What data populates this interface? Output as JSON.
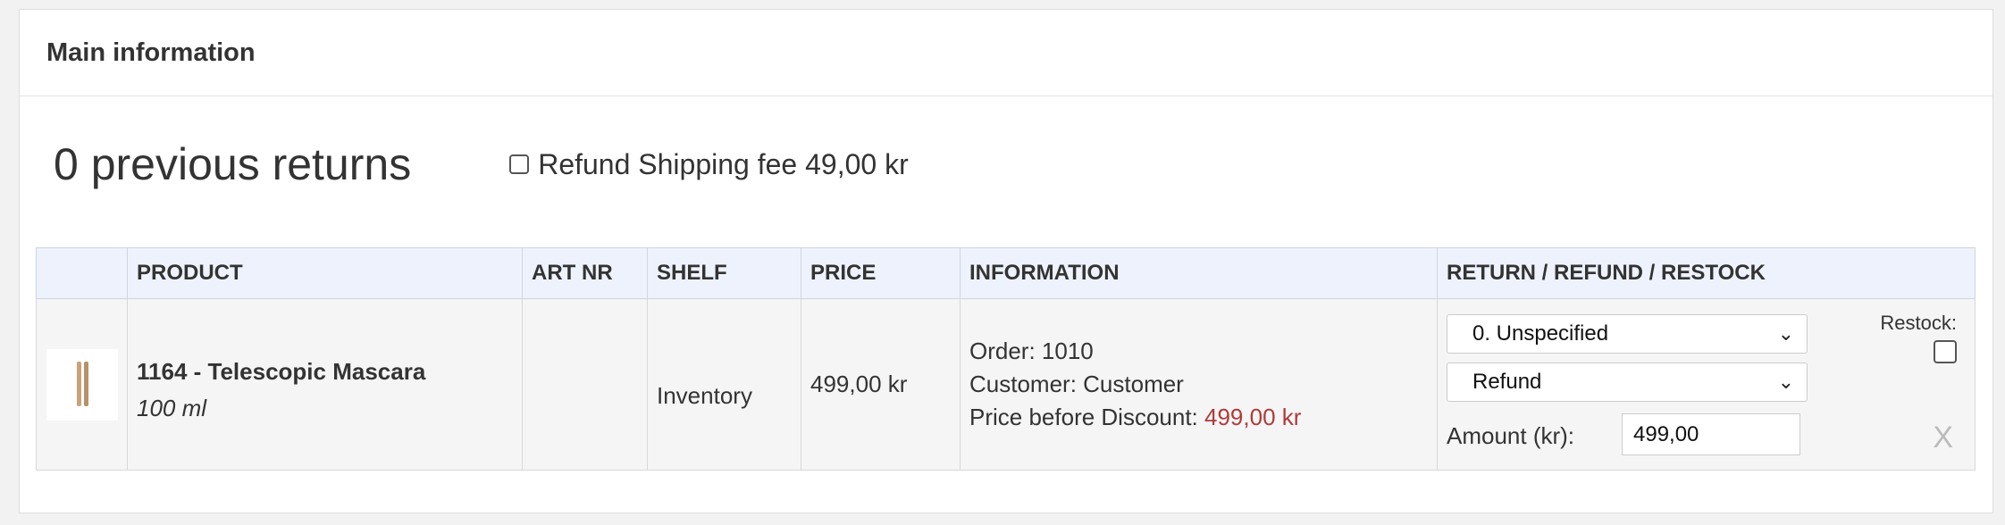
{
  "card": {
    "title": "Main information"
  },
  "summary": {
    "previous_returns": "0 previous returns",
    "refund_shipping_label": "Refund Shipping fee 49,00 kr"
  },
  "table": {
    "headers": [
      "",
      "PRODUCT",
      "ART NR",
      "SHELF",
      "PRICE",
      "INFORMATION",
      "RETURN / REFUND / RESTOCK"
    ],
    "rows": [
      {
        "product_name": "1164 - Telescopic Mascara",
        "product_size": "100 ml",
        "art_nr": "",
        "shelf": "Inventory",
        "price": "499,00 kr",
        "info": {
          "order": "Order: 1010",
          "customer": "Customer: Customer",
          "price_before_label": "Price before Discount: ",
          "price_before_value": "499,00 kr"
        },
        "return_reason": "0. Unspecified",
        "return_type": "Refund",
        "amount_label": "Amount (kr):",
        "amount_value": "499,00",
        "restock_label": "Restock:",
        "remove_label": "X"
      }
    ]
  },
  "colors": {
    "header_bg": "#edf2fc",
    "discount_price": "#b03a3a"
  }
}
